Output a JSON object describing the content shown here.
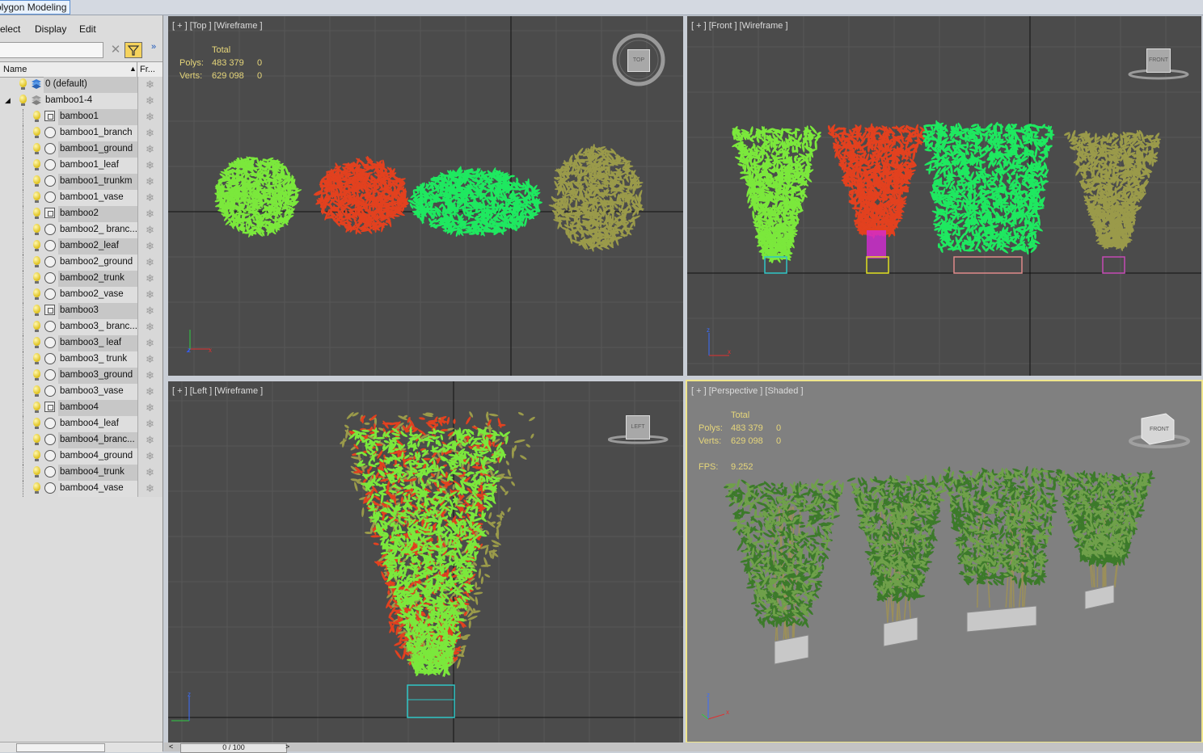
{
  "ribbon": {
    "active_tab": "olygon Modeling"
  },
  "scene_explorer": {
    "menu": [
      "elect",
      "Display",
      "Edit"
    ],
    "search": {
      "value": "",
      "placeholder": ""
    },
    "columns": {
      "name": "Name",
      "frozen": "Fr..."
    },
    "rows": [
      {
        "label": "0 (default)",
        "type": "layer",
        "level": 0
      },
      {
        "label": "bamboo1-4",
        "type": "layer",
        "level": 0,
        "expanded": true
      },
      {
        "label": "bamboo1",
        "type": "group",
        "level": 1
      },
      {
        "label": "bamboo1_branch",
        "type": "object",
        "level": 1
      },
      {
        "label": "bamboo1_ground",
        "type": "object",
        "level": 1
      },
      {
        "label": "bamboo1_leaf",
        "type": "object",
        "level": 1
      },
      {
        "label": "bamboo1_trunkm",
        "type": "object",
        "level": 1
      },
      {
        "label": "bamboo1_vase",
        "type": "object",
        "level": 1
      },
      {
        "label": "bamboo2",
        "type": "group",
        "level": 1
      },
      {
        "label": "bamboo2_ branc...",
        "type": "object",
        "level": 1
      },
      {
        "label": "bamboo2_leaf",
        "type": "object",
        "level": 1
      },
      {
        "label": "bamboo2_ground",
        "type": "object",
        "level": 1
      },
      {
        "label": "bamboo2_trunk",
        "type": "object",
        "level": 1
      },
      {
        "label": "bamboo2_vase",
        "type": "object",
        "level": 1
      },
      {
        "label": "bamboo3",
        "type": "group",
        "level": 1
      },
      {
        "label": "bamboo3_ branc...",
        "type": "object",
        "level": 1
      },
      {
        "label": "bamboo3_ leaf",
        "type": "object",
        "level": 1
      },
      {
        "label": "bamboo3_ trunk",
        "type": "object",
        "level": 1
      },
      {
        "label": "bamboo3_ground",
        "type": "object",
        "level": 1
      },
      {
        "label": "bamboo3_vase",
        "type": "object",
        "level": 1
      },
      {
        "label": "bamboo4",
        "type": "group",
        "level": 1
      },
      {
        "label": "bamboo4_leaf",
        "type": "object",
        "level": 1
      },
      {
        "label": "bamboo4_branc...",
        "type": "object",
        "level": 1
      },
      {
        "label": "bamboo4_ground",
        "type": "object",
        "level": 1
      },
      {
        "label": "bamboo4_trunk",
        "type": "object",
        "level": 1
      },
      {
        "label": "bamboo4_vase",
        "type": "object",
        "level": 1
      }
    ]
  },
  "viewports": {
    "top": {
      "label": "[ + ] [Top ] [Wireframe ]",
      "cube": "TOP",
      "stats": {
        "header": "Total",
        "polys_label": "Polys:",
        "polys": "483 379",
        "polys_sel": "0",
        "verts_label": "Verts:",
        "verts": "629 098",
        "verts_sel": "0"
      }
    },
    "front": {
      "label": "[ + ] [Front ] [Wireframe ]",
      "cube": "FRONT"
    },
    "left": {
      "label": "[ + ] [Left ] [Wireframe ]",
      "cube": "LEFT"
    },
    "perspective": {
      "label": "[ + ] [Perspective ] [Shaded ]",
      "cube": "FRONT",
      "stats": {
        "header": "Total",
        "polys_label": "Polys:",
        "polys": "483 379",
        "polys_sel": "0",
        "verts_label": "Verts:",
        "verts": "629 098",
        "verts_sel": "0",
        "fps_label": "FPS:",
        "fps": "9.252"
      }
    }
  },
  "axes": {
    "z": "z",
    "x": "x"
  },
  "timeline": {
    "prev": "<",
    "value": "0 / 100",
    "next": ">"
  },
  "colors": {
    "viewport_bg": "#4b4b4b",
    "perspective_bg": "#808080",
    "active_border": "#f0e68c",
    "stats": "#e6d67a",
    "bamboo1": "#7be83c",
    "bamboo2": "#e2411f",
    "bamboo3": "#1fe860",
    "bamboo4": "#9a9a4a"
  }
}
